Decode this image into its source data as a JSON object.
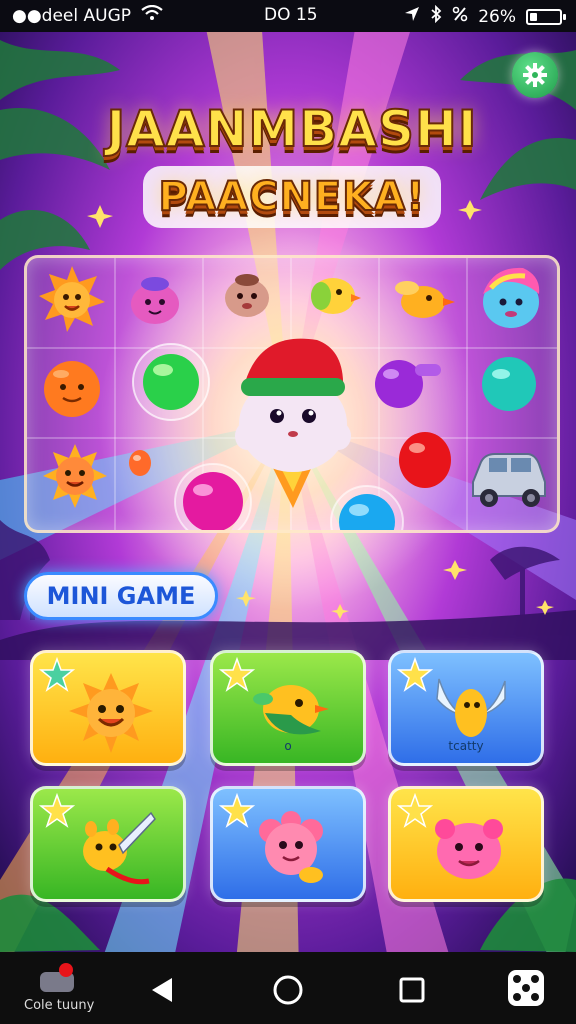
{
  "status_bar": {
    "carrier": "●●deel AUGP",
    "time": "DO 15",
    "battery_percent": "26%",
    "battery_level": 0.26,
    "icons": [
      "wifi-icon",
      "location-arrow-icon",
      "bluetooth-icon",
      "alarm-icon"
    ]
  },
  "title": {
    "line1": "JAANMBASHI",
    "line2": "PAACNEKA!"
  },
  "settings": {
    "icon": "gear-icon",
    "color": "#2fb55a"
  },
  "board": {
    "pieces": [
      "sun-creature",
      "pink-blob",
      "brown-blob",
      "yellow-bird",
      "orange-bird",
      "rainbow-unicorn",
      "orange-ball",
      "green-orb",
      "purple-potion",
      "teal-orb",
      "sun-creature",
      "orange-candy",
      "magenta-orb",
      "blue-orb",
      "red-orb",
      "toy-car"
    ],
    "center_character": "mascot-with-red-hat"
  },
  "mini_game": {
    "label": "MINI GAME"
  },
  "levels": [
    {
      "character": "sun-creature",
      "label": "",
      "color": "yellow"
    },
    {
      "character": "bird-creature",
      "label": "o",
      "color": "green"
    },
    {
      "character": "winged-creature",
      "label": "tcatty",
      "color": "blue"
    },
    {
      "character": "sword-creature",
      "label": "",
      "color": "green"
    },
    {
      "character": "pink-flower-creature",
      "label": "",
      "color": "blue"
    },
    {
      "character": "pink-blob-creature",
      "label": "",
      "color": "yellow"
    }
  ],
  "nav": {
    "app_label": "Cole tuuny",
    "buttons": [
      "back-icon",
      "home-icon",
      "recents-icon",
      "dice-icon"
    ]
  }
}
